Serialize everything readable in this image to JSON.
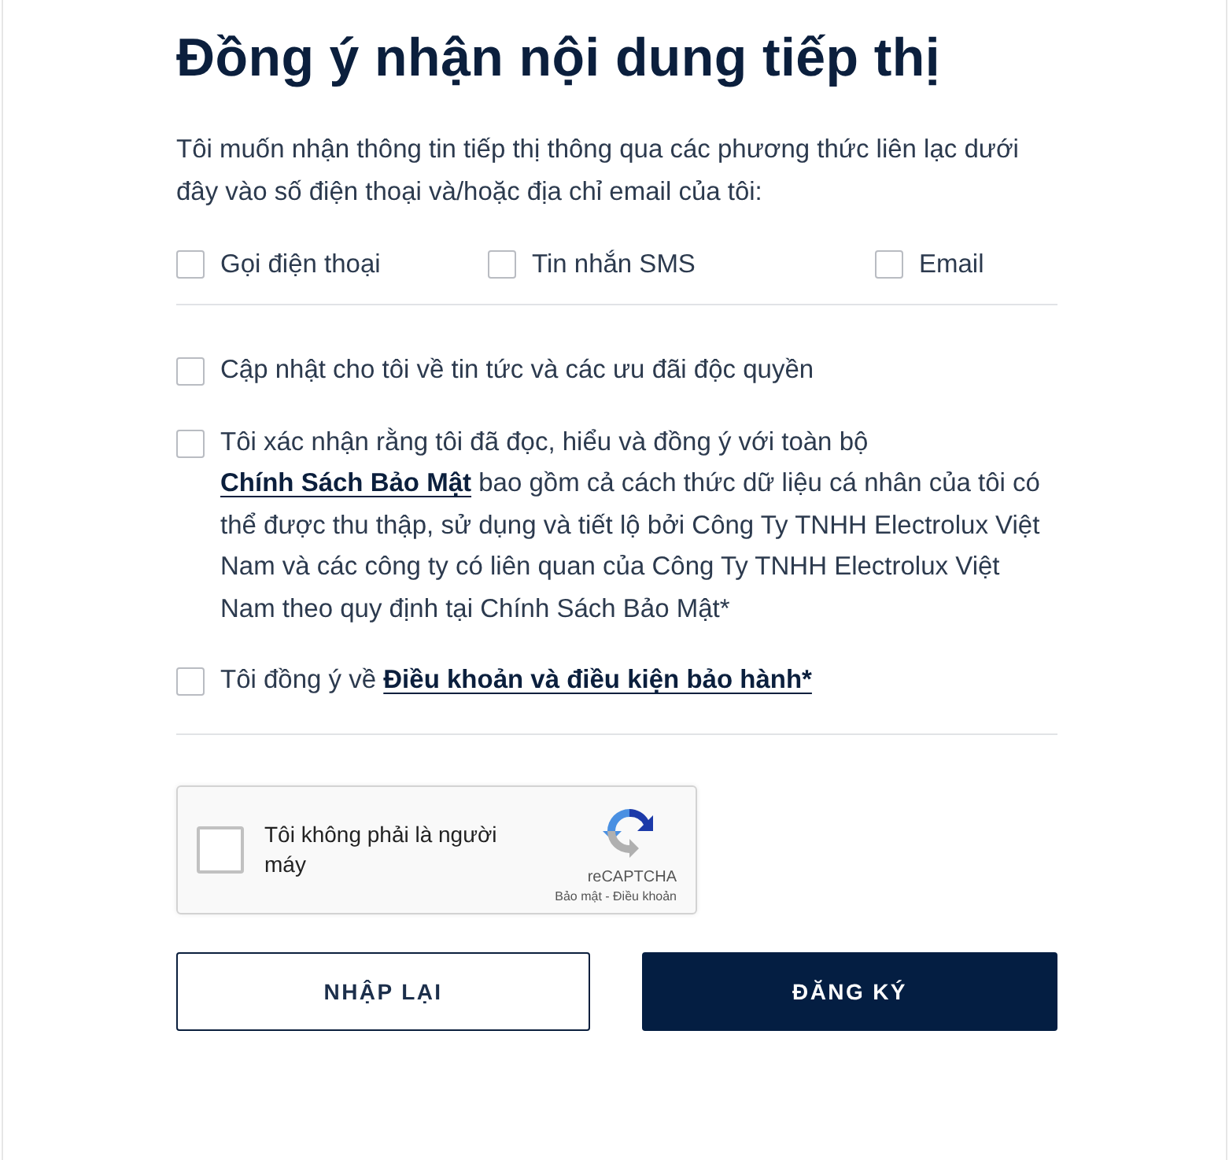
{
  "title": "Đồng ý nhận nội dung tiếp thị",
  "intro": "Tôi muốn nhận thông tin tiếp thị thông qua các phương thức liên lạc dưới đây vào số điện thoại và/hoặc địa chỉ email của tôi:",
  "channels": [
    {
      "label": "Gọi điện thoại",
      "checked": false
    },
    {
      "label": "Tin nhắn SMS",
      "checked": false
    },
    {
      "label": "Email",
      "checked": false
    }
  ],
  "consents": [
    {
      "checked": false,
      "parts": [
        {
          "kind": "text",
          "text": "Cập nhật cho tôi về tin tức và các ưu đãi độc quyền"
        }
      ]
    },
    {
      "checked": false,
      "parts": [
        {
          "kind": "text",
          "text": "Tôi xác nhận rằng tôi đã đọc, hiểu và đồng ý với toàn bộ "
        },
        {
          "kind": "link",
          "text": "Chính Sách Bảo Mật"
        },
        {
          "kind": "text",
          "text": " bao gồm cả cách thức dữ liệu cá nhân của tôi có thể được thu thập, sử dụng và tiết lộ bởi Công Ty TNHH Electrolux Việt Nam và các công ty có liên quan của Công Ty TNHH Electrolux Việt Nam theo quy định tại Chính Sách Bảo Mật*"
        }
      ]
    },
    {
      "checked": false,
      "parts": [
        {
          "kind": "text",
          "text": "Tôi đồng ý về "
        },
        {
          "kind": "link",
          "text": "Điều khoản và điều kiện bảo hành*"
        }
      ]
    }
  ],
  "captcha": {
    "checked": false,
    "label": "Tôi không phải là người máy",
    "brand": "reCAPTCHA",
    "terms": "Bảo mật - Điều khoản"
  },
  "buttons": [
    {
      "label": "NHẬP LẠI",
      "kind": "secondary"
    },
    {
      "label": "ĐĂNG KÝ",
      "kind": "primary"
    }
  ]
}
